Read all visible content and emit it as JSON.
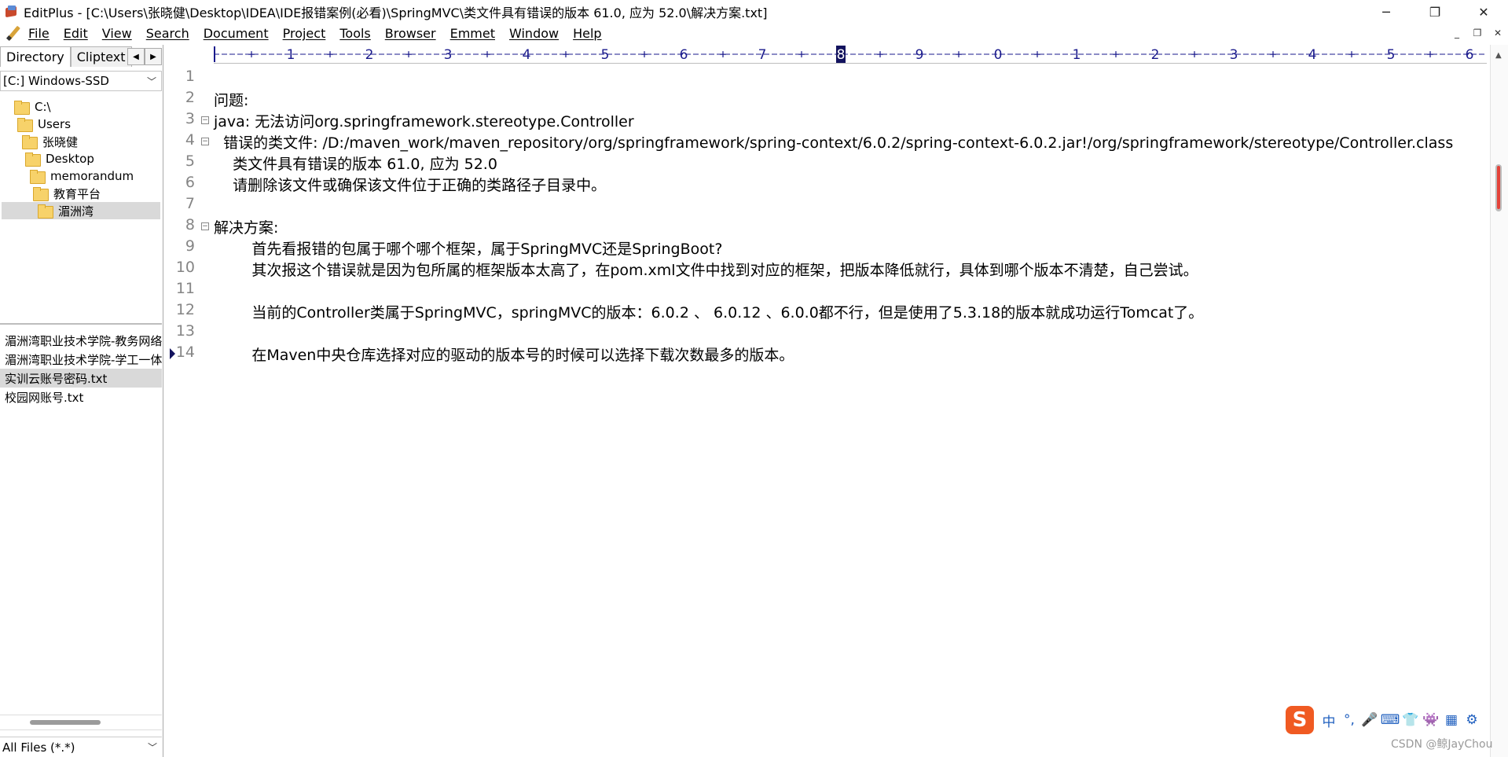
{
  "window": {
    "title": "EditPlus - [C:\\Users\\张晓健\\Desktop\\IDEA\\IDE报错案例(必看)\\SpringMVC\\类文件具有错误的版本 61.0, 应为 52.0\\解决方案.txt]",
    "minimize": "─",
    "maximize": "❐",
    "close": "✕"
  },
  "menu": {
    "items": [
      "File",
      "Edit",
      "View",
      "Search",
      "Document",
      "Project",
      "Tools",
      "Browser",
      "Emmet",
      "Window",
      "Help"
    ],
    "mdi_minimize": "_",
    "mdi_restore": "❐",
    "mdi_close": "✕"
  },
  "sidebar": {
    "tabs": [
      "Directory",
      "Cliptext"
    ],
    "arrow_left": "◀",
    "arrow_right": "▶",
    "drive": "[C:] Windows-SSD",
    "tree": [
      "C:\\",
      "Users",
      "张晓健",
      "Desktop",
      "memorandum",
      "教育平台",
      "湄洲湾"
    ],
    "selected_tree_item": "湄洲湾",
    "files": [
      "湄洲湾职业技术学院-教务网络",
      "湄洲湾职业技术学院-学工一体",
      "实训云账号密码.txt",
      "校园网账号.txt"
    ],
    "selected_file": "实训云账号密码.txt",
    "filter": "All Files (*.*)"
  },
  "ruler": {
    "labels": [
      "1",
      "2",
      "3",
      "4",
      "5",
      "6",
      "7",
      "8",
      "9",
      "0",
      "1",
      "2",
      "3",
      "4",
      "5",
      "6"
    ],
    "highlighted_label": "8"
  },
  "editor": {
    "lines": [
      "",
      "问题:",
      "java: 无法访问org.springframework.stereotype.Controller",
      "  错误的类文件: /D:/maven_work/maven_repository/org/springframework/spring-context/6.0.2/spring-context-6.0.2.jar!/org/springframework/stereotype/Controller.class",
      "    类文件具有错误的版本 61.0, 应为 52.0",
      "    请删除该文件或确保该文件位于正确的类路径子目录中。",
      "",
      "解决方案:",
      "        首先看报错的包属于哪个哪个框架，属于SpringMVC还是SpringBoot?",
      "        其次报这个错误就是因为包所属的框架版本太高了，在pom.xml文件中找到对应的框架，把版本降低就行，具体到哪个版本不清楚，自己尝试。",
      "",
      "        当前的Controller类属于SpringMVC，springMVC的版本：6.0.2 、 6.0.12 、6.0.0都不行，但是使用了5.3.18的版本就成功运行Tomcat了。",
      "",
      "        在Maven中央仓库选择对应的驱动的版本号的时候可以选择下载次数最多的版本。"
    ],
    "line_numbers": [
      "1",
      "2",
      "3",
      "4",
      "5",
      "6",
      "7",
      "8",
      "9",
      "10",
      "11",
      "12",
      "13",
      "14"
    ],
    "fold_marker": "⊟",
    "current_line": 14
  },
  "ime": {
    "logo": "S",
    "items": [
      "中",
      "°,",
      "🎤",
      "⌨",
      "👕",
      "👾",
      "▦",
      "⚙"
    ]
  },
  "watermark": "CSDN @鲸JayChou",
  "colors": {
    "ruler_text": "#1a1a8c",
    "ruler_highlight": "#13135e",
    "ime_logo": "#f05a22",
    "ime_icons": "#1f5fbf"
  }
}
